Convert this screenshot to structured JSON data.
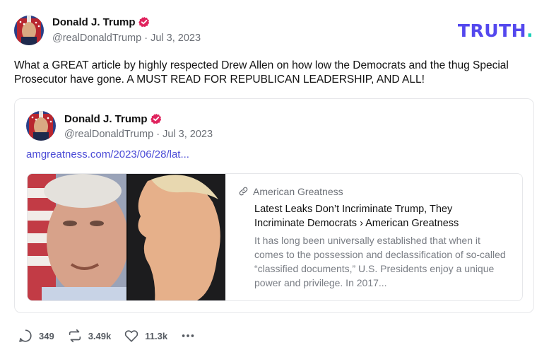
{
  "post": {
    "author_name": "Donald J. Trump",
    "handle": "@realDonaldTrump",
    "separator": "·",
    "date": "Jul 3, 2023",
    "text": "What a GREAT article by highly respected Drew Allen on how low the Democrats and the thug Special Prosecutor have gone. A MUST READ FOR REPUBLICAN LEADERSHIP, AND ALL!"
  },
  "brand": {
    "name": "TRUTH",
    "dot": "."
  },
  "quote": {
    "author_name": "Donald J. Trump",
    "handle": "@realDonaldTrump",
    "separator": "·",
    "date": "Jul 3, 2023",
    "link_text": "amgreatness.com/2023/06/28/lat...",
    "card": {
      "source": "American Greatness",
      "title": "Latest Leaks Don’t Incriminate Trump, They Incriminate Democrats › American Greatness",
      "description": "It has long been universally established that when it comes to the possession and declassification of so-called “classified documents,” U.S. Presidents enjoy a unique power and privilege. In 2017..."
    }
  },
  "actions": {
    "replies": "349",
    "retruths": "3.49k",
    "likes": "11.3k"
  },
  "colors": {
    "brand": "#5448ee",
    "brand_dot": "#18d0b8",
    "verified": "#e0245e",
    "link": "#4b4bd6"
  },
  "icons": [
    "verified-badge-icon",
    "link-icon",
    "reply-icon",
    "retruth-icon",
    "like-icon",
    "more-icon"
  ]
}
